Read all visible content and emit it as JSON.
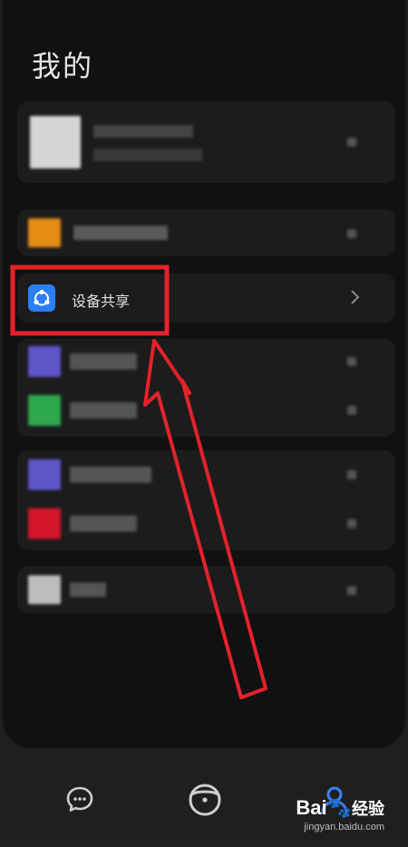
{
  "header": {
    "title": "我的"
  },
  "device_share": {
    "label": "设备共享",
    "chevron": "chevron-right-icon"
  },
  "tabbar": {
    "items": [
      {
        "id": "messages",
        "icon": "chat-bubble-icon"
      },
      {
        "id": "home",
        "icon": "smart-home-icon"
      },
      {
        "id": "profile",
        "icon": "profile-icon"
      }
    ]
  },
  "watermark": {
    "brand": "Bai",
    "brand_suffix": "经验",
    "url": "jingyan.baidu.com"
  },
  "colors": {
    "annotation_red": "#e4222a",
    "accent_blue": "#2c7ff6",
    "card_bg": "#1c1c1c",
    "panel_bg": "#111111"
  }
}
